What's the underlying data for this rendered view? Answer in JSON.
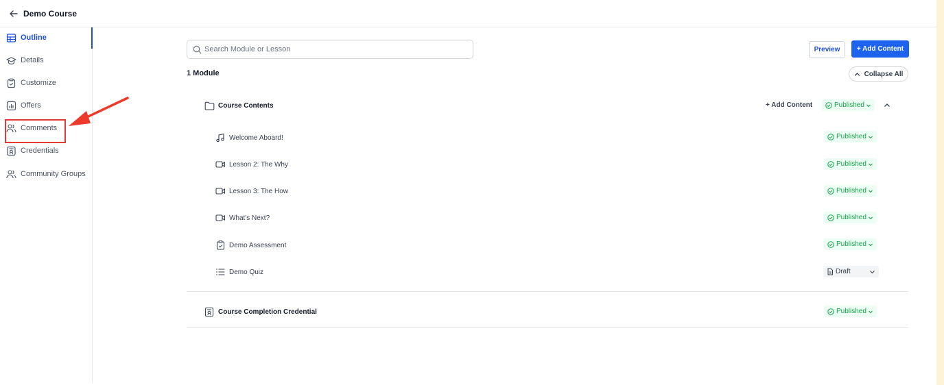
{
  "header": {
    "title": "Demo Course"
  },
  "sidebar": {
    "items": [
      {
        "label": "Outline",
        "icon": "table-icon",
        "active": true
      },
      {
        "label": "Details",
        "icon": "graduation-cap-icon"
      },
      {
        "label": "Customize",
        "icon": "clipboard-icon"
      },
      {
        "label": "Offers",
        "icon": "bar-chart-icon"
      },
      {
        "label": "Comments",
        "icon": "users-icon"
      },
      {
        "label": "Credentials",
        "icon": "certificate-icon"
      },
      {
        "label": "Community Groups",
        "icon": "users-icon"
      }
    ]
  },
  "toolbar": {
    "search_placeholder": "Search Module or Lesson",
    "preview_label": "Preview",
    "add_content_label": "+ Add Content"
  },
  "outline": {
    "module_count": "1 Module",
    "collapse_all_label": "Collapse All",
    "module": {
      "title": "Course Contents",
      "add_content_label": "+ Add Content",
      "status": "Published",
      "lessons": [
        {
          "title": "Welcome Aboard!",
          "icon": "music-note-icon",
          "status": "Published"
        },
        {
          "title": "Lesson 2: The Why",
          "icon": "video-icon",
          "status": "Published"
        },
        {
          "title": "Lesson 3: The How",
          "icon": "video-icon",
          "status": "Published"
        },
        {
          "title": "What's Next?",
          "icon": "video-icon",
          "status": "Published"
        },
        {
          "title": "Demo Assessment",
          "icon": "clipboard-check-icon",
          "status": "Published"
        },
        {
          "title": "Demo Quiz",
          "icon": "list-icon",
          "status": "Draft"
        }
      ]
    },
    "credential": {
      "title": "Course Completion Credential",
      "icon": "certificate-icon",
      "status": "Published"
    }
  },
  "colors": {
    "primary": "#1d63ed",
    "accent_text": "#1d4ed8",
    "published": "#16a34a",
    "published_bg": "#ecfdf3",
    "annotation": "#e53935"
  }
}
